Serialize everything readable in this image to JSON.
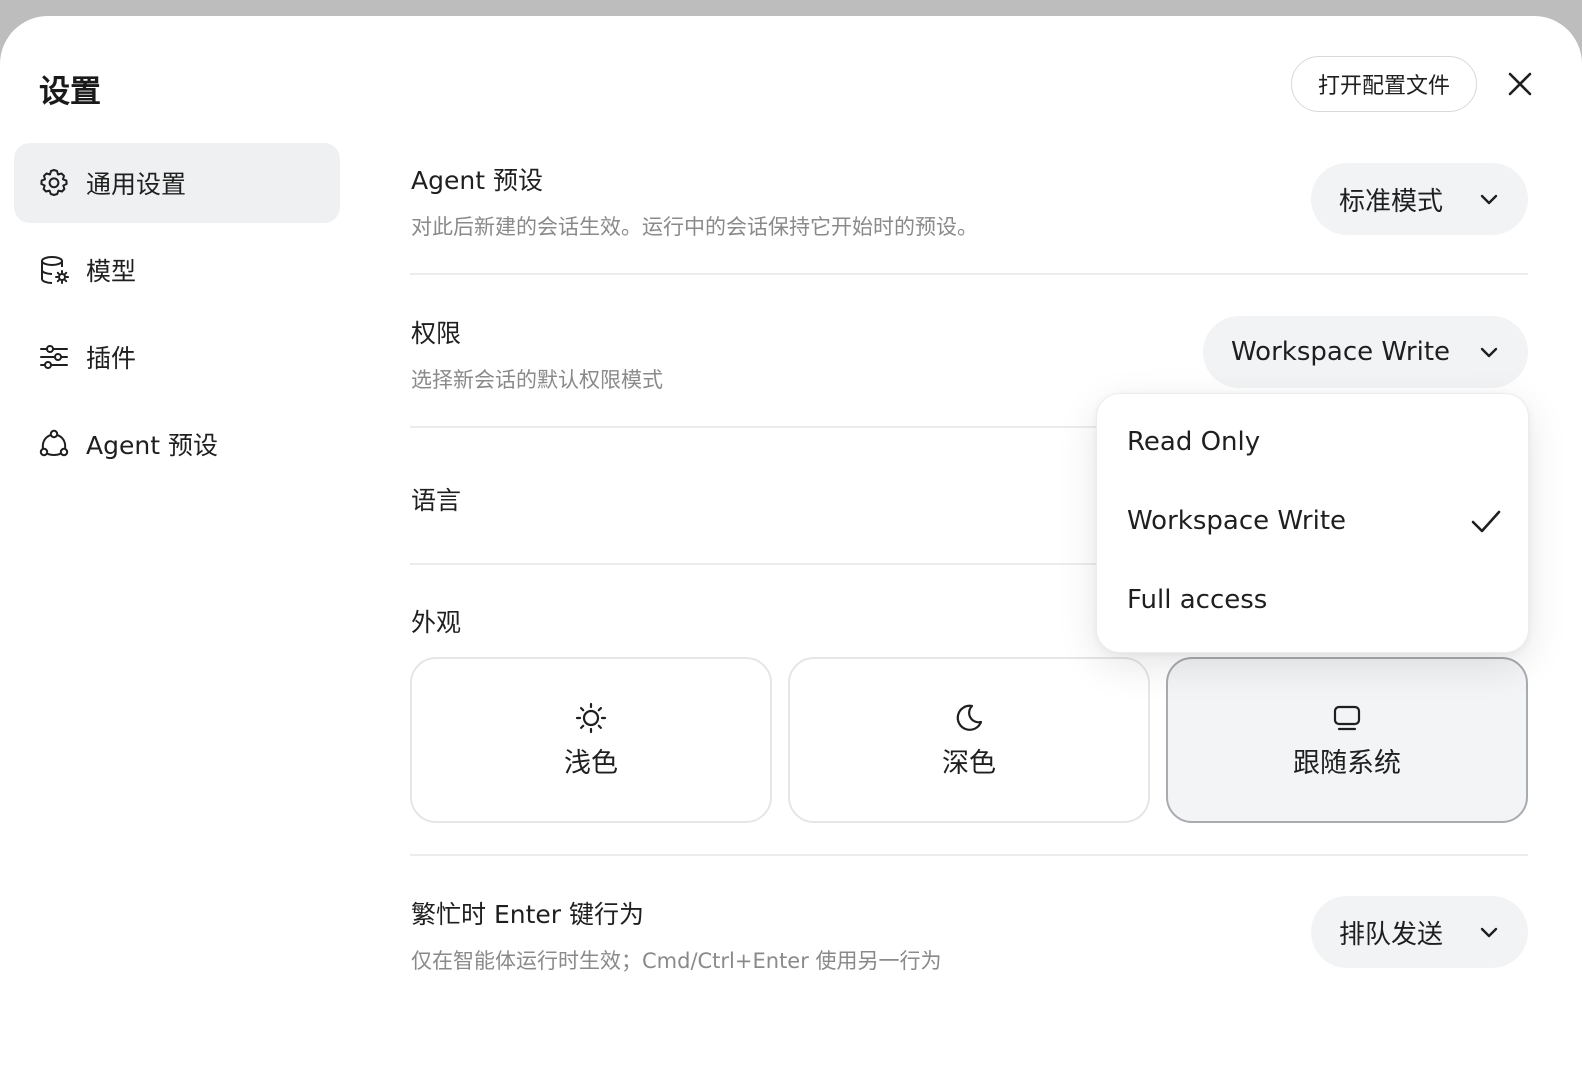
{
  "window": {
    "title": "设置",
    "open_config_label": "打开配置文件"
  },
  "sidebar": {
    "items": [
      {
        "label": "通用设置",
        "icon": "gear-icon",
        "active": true
      },
      {
        "label": "模型",
        "icon": "database-gear-icon",
        "active": false
      },
      {
        "label": "插件",
        "icon": "sliders-icon",
        "active": false
      },
      {
        "label": "Agent 预设",
        "icon": "agent-nodes-icon",
        "active": false
      }
    ]
  },
  "settings": {
    "agent_preset": {
      "title": "Agent 预设",
      "description": "对此后新建的会话生效。运行中的会话保持它开始时的预设。",
      "value": "标准模式"
    },
    "permissions": {
      "title": "权限",
      "description": "选择新会话的默认权限模式",
      "value": "Workspace Write",
      "options": [
        "Read Only",
        "Workspace Write",
        "Full access"
      ],
      "selected_option": "Workspace Write"
    },
    "language": {
      "title": "语言"
    },
    "appearance": {
      "title": "外观",
      "options": [
        {
          "label": "浅色",
          "icon": "sun-icon"
        },
        {
          "label": "深色",
          "icon": "moon-icon"
        },
        {
          "label": "跟随系统",
          "icon": "monitor-icon"
        }
      ],
      "selected": "跟随系统"
    },
    "busy_enter": {
      "title": "繁忙时 Enter 键行为",
      "description": "仅在智能体运行时生效；Cmd/Ctrl+Enter 使用另一行为",
      "value": "排队发送"
    }
  },
  "colors": {
    "backdrop": "#bdbdbd",
    "active_nav_bg": "#eff0f2",
    "select_bg": "#f2f3f5",
    "muted_text": "#8a8a8a"
  }
}
